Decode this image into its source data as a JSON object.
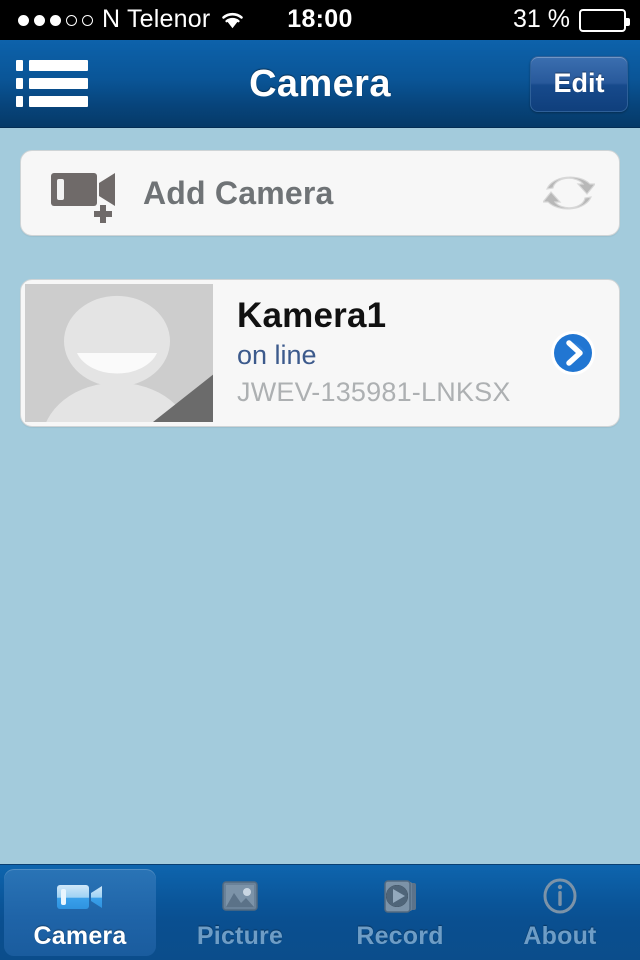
{
  "status_bar": {
    "signal_dots_total": 5,
    "signal_dots_filled": 3,
    "carrier": "N Telenor",
    "wifi_icon": "wifi-icon",
    "time": "18:00",
    "battery_percent_label": "31 %",
    "battery_level": 31
  },
  "nav_bar": {
    "menu_icon": "list-menu-icon",
    "title": "Camera",
    "edit_label": "Edit"
  },
  "add_camera_row": {
    "icon": "camcorder-plus-icon",
    "label": "Add Camera",
    "refresh_icon": "refresh-icon"
  },
  "camera_list": [
    {
      "thumbnail_icon": "person-placeholder-thumbnail",
      "name": "Kamera1",
      "status": "on line",
      "uid": "JWEV-135981-LNKSX",
      "disclosure_icon": "chevron-right-icon"
    }
  ],
  "tab_bar": {
    "active_index": 0,
    "tabs": [
      {
        "label": "Camera",
        "icon": "camcorder-icon"
      },
      {
        "label": "Picture",
        "icon": "photo-icon"
      },
      {
        "label": "Record",
        "icon": "video-play-stack-icon"
      },
      {
        "label": "About",
        "icon": "info-circle-icon"
      }
    ]
  },
  "colors": {
    "background": "#a3cbdc",
    "nav_blue": "#0a5599",
    "accent_blue": "#2176d2",
    "status_text": "#3c5a8c",
    "uid_text": "#adb0b2"
  }
}
